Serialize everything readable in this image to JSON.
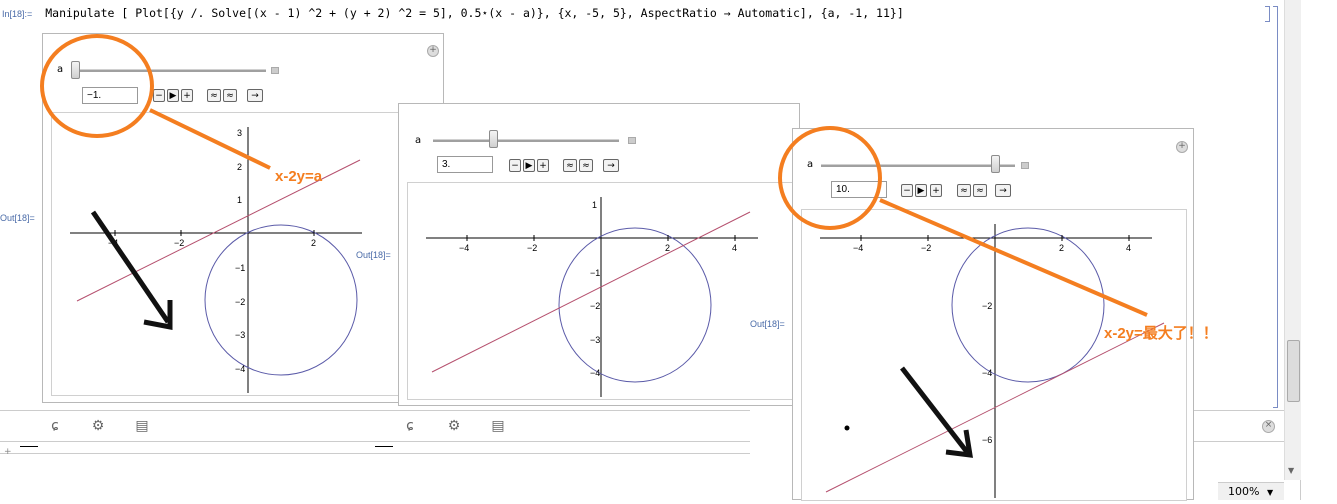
{
  "input": {
    "label": "In[18]:=",
    "code": "Manipulate [ Plot[{y /. Solve[(x - 1) ^2 + (y + 2) ^2 = 5], 0.5⋆(x - a)}, {x, -5, 5}, AspectRatio → Automatic], {a, -1, 11}]"
  },
  "panels": [
    {
      "slider_label": "a",
      "value": "−1.",
      "out_label": "Out[18]="
    },
    {
      "slider_label": "a",
      "value": "3.",
      "out_label": "Out[18]="
    },
    {
      "slider_label": "a",
      "value": "10.",
      "out_label": "Out[18]="
    }
  ],
  "controls": {
    "minus": "−",
    "play": "▶",
    "plus": "+",
    "faster": "≈",
    "slower": "≈",
    "direction": "→"
  },
  "plot1": {
    "xticks": [
      "−4",
      "−2",
      "2"
    ],
    "yticks": [
      "3",
      "2",
      "1",
      "−1",
      "−2",
      "−3",
      "−4"
    ]
  },
  "plot2": {
    "xticks": [
      "−4",
      "−2",
      "2",
      "4"
    ],
    "yticks": [
      "1",
      "−1",
      "−2",
      "−3",
      "−4"
    ]
  },
  "plot3": {
    "xticks": [
      "−4",
      "−2",
      "2",
      "4"
    ],
    "yticks": [
      "−2",
      "−4",
      "−6"
    ]
  },
  "annotations": {
    "label1": "x-2y=a",
    "label2": "x-2y=最大了！！"
  },
  "status": {
    "zoom": "100%"
  },
  "colors": {
    "annotation": "#f47e20",
    "circle": "#5a5aa8",
    "line": "#b5506e"
  }
}
